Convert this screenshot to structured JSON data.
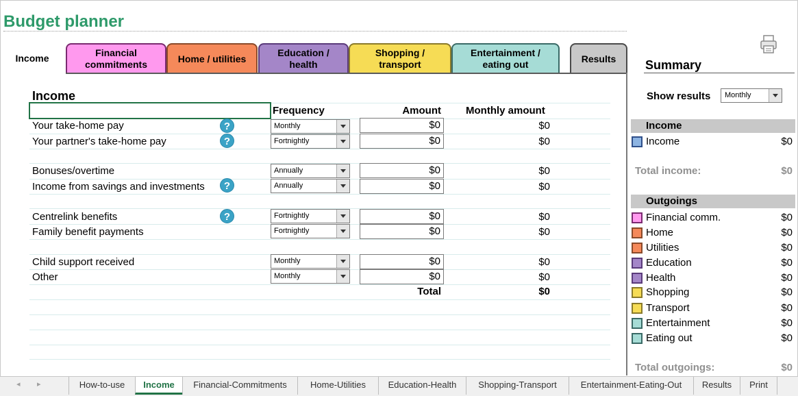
{
  "app_title": "Budget planner",
  "tabs": [
    {
      "label": "Income",
      "color": "#ffffff"
    },
    {
      "label": "Financial commitments",
      "color": "#ff99ee"
    },
    {
      "label": "Home / utilities",
      "color": "#f5895a"
    },
    {
      "label": "Education / health",
      "color": "#a486c8"
    },
    {
      "label": "Shopping / transport",
      "color": "#f6dc55"
    },
    {
      "label": "Entertainment / eating out",
      "color": "#a6dcd6"
    },
    {
      "label": "Results",
      "color": "#c8c8c8"
    }
  ],
  "main": {
    "section_title": "Income",
    "headers": {
      "frequency": "Frequency",
      "amount": "Amount",
      "monthly": "Monthly amount"
    },
    "rows": [
      {
        "label": "Your take-home pay",
        "help": true,
        "frequency": "Monthly",
        "amount": "$0",
        "monthly": "$0"
      },
      {
        "label": "Your partner's take-home pay",
        "help": true,
        "frequency": "Fortnightly",
        "amount": "$0",
        "monthly": "$0"
      },
      {
        "label": "Bonuses/overtime",
        "help": false,
        "frequency": "Annually",
        "amount": "$0",
        "monthly": "$0"
      },
      {
        "label": "Income from savings and investments",
        "help": true,
        "frequency": "Annually",
        "amount": "$0",
        "monthly": "$0"
      },
      {
        "label": "Centrelink benefits",
        "help": true,
        "frequency": "Fortnightly",
        "amount": "$0",
        "monthly": "$0"
      },
      {
        "label": "Family benefit payments",
        "help": false,
        "frequency": "Fortnightly",
        "amount": "$0",
        "monthly": "$0"
      },
      {
        "label": "Child support received",
        "help": false,
        "frequency": "Monthly",
        "amount": "$0",
        "monthly": "$0"
      },
      {
        "label": "Other",
        "help": false,
        "frequency": "Monthly",
        "amount": "$0",
        "monthly": "$0"
      }
    ],
    "help_glyph": "?",
    "total_label": "Total",
    "total_value": "$0"
  },
  "summary": {
    "title": "Summary",
    "show_results_label": "Show results",
    "show_results_value": "Monthly",
    "income_heading": "Income",
    "income_items": [
      {
        "label": "Income",
        "value": "$0",
        "color": "#8db4e2"
      }
    ],
    "total_income_label": "Total income:",
    "total_income_value": "$0",
    "outgoings_heading": "Outgoings",
    "outgoing_items": [
      {
        "label": "Financial comm.",
        "value": "$0",
        "color": "#ff99ee"
      },
      {
        "label": "Home",
        "value": "$0",
        "color": "#f5895a"
      },
      {
        "label": "Utilities",
        "value": "$0",
        "color": "#f5895a"
      },
      {
        "label": "Education",
        "value": "$0",
        "color": "#a486c8"
      },
      {
        "label": "Health",
        "value": "$0",
        "color": "#a486c8"
      },
      {
        "label": "Shopping",
        "value": "$0",
        "color": "#f6dc55"
      },
      {
        "label": "Transport",
        "value": "$0",
        "color": "#f6dc55"
      },
      {
        "label": "Entertainment",
        "value": "$0",
        "color": "#a6dcd6"
      },
      {
        "label": "Eating out",
        "value": "$0",
        "color": "#a6dcd6"
      }
    ],
    "total_outgoings_label": "Total outgoings:",
    "total_outgoings_value": "$0"
  },
  "sheet_tabs": [
    {
      "label": "How-to-use",
      "active": false
    },
    {
      "label": "Income",
      "active": true
    },
    {
      "label": "Financial-Commitments",
      "active": false
    },
    {
      "label": "Home-Utilities",
      "active": false
    },
    {
      "label": "Education-Health",
      "active": false
    },
    {
      "label": "Shopping-Transport",
      "active": false
    },
    {
      "label": "Entertainment-Eating-Out",
      "active": false
    },
    {
      "label": "Results",
      "active": false
    },
    {
      "label": "Print",
      "active": false
    }
  ],
  "icons": {
    "print": "printer-icon",
    "help": "help-icon",
    "nav_prev": "◂",
    "nav_next": "▸"
  }
}
